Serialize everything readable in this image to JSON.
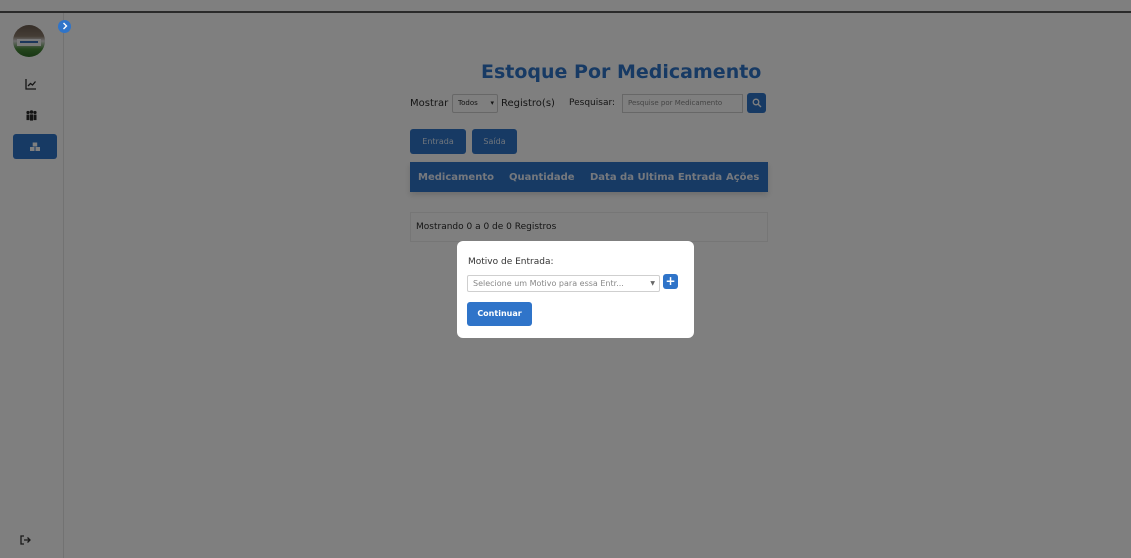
{
  "colors": {
    "accent": "#2f74c9",
    "overlay": "rgba(0,0,0,0.5)",
    "sidebar_bg": "#ffffff"
  },
  "sidebar": {
    "toggle_icon": "chevron-right-icon",
    "items": [
      {
        "icon": "chart-line-icon",
        "glyph": "⟋",
        "active": false
      },
      {
        "icon": "users-icon",
        "glyph": "👥",
        "active": false
      },
      {
        "icon": "warehouse-icon",
        "glyph": "▦",
        "active": true
      }
    ],
    "logout_icon": "sign-out-icon",
    "logout_glyph": "↦"
  },
  "page": {
    "title": "Estoque Por Medicamento",
    "show_label": "Mostrar",
    "show_value": "Todos",
    "registros_label": "Registro(s)",
    "search_label": "Pesquisar:",
    "search_placeholder": "Pesquise por Medicamento",
    "entrada_button": "Entrada",
    "saida_button": "Saída",
    "table_headers": [
      "Medicamento",
      "Quantidade",
      "Data da Ultima Entrada",
      "Ações"
    ],
    "info_text": "Mostrando 0 a 0 de 0 Registros"
  },
  "modal": {
    "label": "Motivo de Entrada:",
    "select_placeholder": "Selecione um Motivo para essa Entr...",
    "add_label": "+",
    "continue_button": "Continuar"
  }
}
